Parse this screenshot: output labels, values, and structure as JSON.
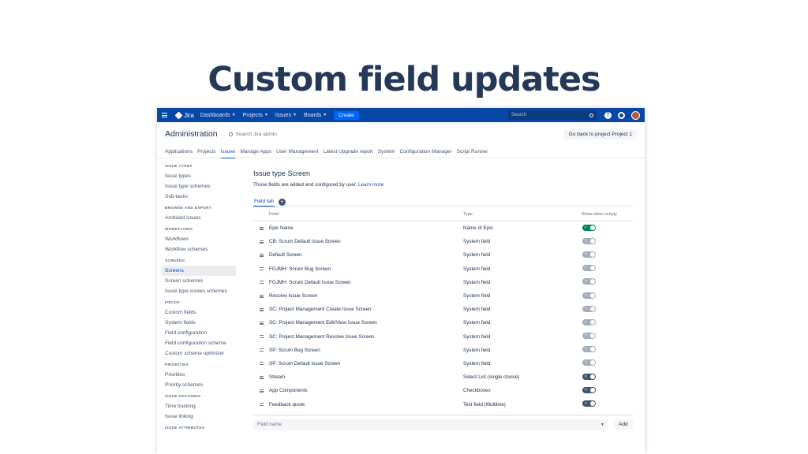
{
  "hero": {
    "title": "Custom field updates"
  },
  "topnav": {
    "logo": "Jira",
    "items": [
      {
        "label": "Dashboards"
      },
      {
        "label": "Projects"
      },
      {
        "label": "Issues"
      },
      {
        "label": "Boards"
      }
    ],
    "create_label": "Create",
    "search_placeholder": "Search"
  },
  "admin": {
    "title": "Administration",
    "search_placeholder": "Search Jira admin",
    "go_back_label": "Go back to project Project 1",
    "tabs": [
      {
        "label": "Applications"
      },
      {
        "label": "Projects"
      },
      {
        "label": "Issues"
      },
      {
        "label": "Manage Apps"
      },
      {
        "label": "User Management"
      },
      {
        "label": "Latest Upgrade report"
      },
      {
        "label": "System"
      },
      {
        "label": "Configuration Manager"
      },
      {
        "label": "Script Runner"
      }
    ]
  },
  "sidebar": {
    "sections": [
      {
        "title": "ISSUE TYPES",
        "items": [
          "Issue types",
          "Issue type schemes",
          "Sub-tasks"
        ]
      },
      {
        "title": "BROWSE AND EXPORT",
        "items": [
          "Archived issues"
        ]
      },
      {
        "title": "WORKFLOWS",
        "items": [
          "Workflows",
          "Workflow schemes"
        ]
      },
      {
        "title": "SCREENS",
        "items": [
          "Screens",
          "Screen schemes",
          "Issue type screen schemes"
        ]
      },
      {
        "title": "FIELDS",
        "items": [
          "Custom fields",
          "System fields",
          "Field configuration",
          "Field configuration scheme",
          "Custom scheme optimizer"
        ]
      },
      {
        "title": "PRIORITIES",
        "items": [
          "Priorities",
          "Priority schemes"
        ]
      },
      {
        "title": "ISSUE FEATURES",
        "items": [
          "Time tracking",
          "Issue linking"
        ]
      },
      {
        "title": "ISSUE ATTRIBUTES",
        "items": []
      }
    ]
  },
  "main": {
    "title": "Issue type Screen",
    "description": "Those fields are added and configured by user.",
    "learn_more": "Learn more",
    "field_tab": "Field tab",
    "columns": {
      "field": "Field",
      "type": "Type",
      "show": "Show when empty"
    },
    "rows": [
      {
        "field": "Epic Name",
        "type": "Name of Epic",
        "toggle": "on"
      },
      {
        "field": "CB: Scrum Default Issue Screen",
        "type": "System field",
        "toggle": "off"
      },
      {
        "field": "Default Screen",
        "type": "System field",
        "toggle": "off"
      },
      {
        "field": "FGJMH: Scrum Bug Screen",
        "type": "System field",
        "toggle": "off"
      },
      {
        "field": "FGJMH: Scrum Default Issue Screen",
        "type": "System field",
        "toggle": "off"
      },
      {
        "field": "Resolve Issue Screen",
        "type": "System field",
        "toggle": "off"
      },
      {
        "field": "SC: Project Management Create Issue Screen",
        "type": "System field",
        "toggle": "off"
      },
      {
        "field": "SC: Project Management Edit/View Issue Screen",
        "type": "System field",
        "toggle": "off"
      },
      {
        "field": "SC: Project Management Resolve Issue Screen",
        "type": "System field",
        "toggle": "off"
      },
      {
        "field": "SP: Scrum Bug Screen",
        "type": "System field",
        "toggle": "off"
      },
      {
        "field": "SP: Scrum Default Issue Screen",
        "type": "System field",
        "toggle": "off"
      },
      {
        "field": "Stream",
        "type": "Select List (single choice)",
        "toggle": "dark"
      },
      {
        "field": "App Components",
        "type": "Checkboxes",
        "toggle": "dark"
      },
      {
        "field": "Feedback quote",
        "type": "Text field (Multiline)",
        "toggle": "dark"
      }
    ],
    "field_name_placeholder": "Field name",
    "add_label": "Add"
  }
}
